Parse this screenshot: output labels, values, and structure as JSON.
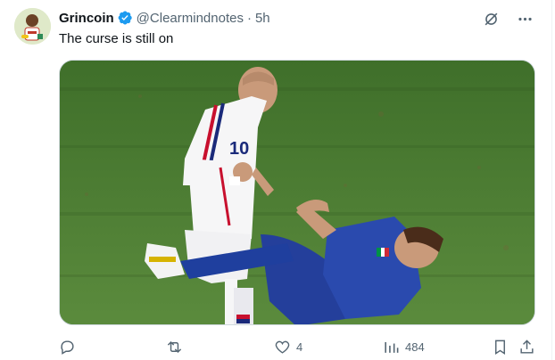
{
  "post": {
    "author_name": "Grincoin",
    "handle": "@Clearmindnotes",
    "separator": "·",
    "time": "5h",
    "text": "The curse is still on",
    "verified": true
  },
  "actions": {
    "reply_count": "",
    "repost_count": "",
    "like_count": "4",
    "views_count": "484"
  },
  "icons": {
    "header": [
      "verified-badge-icon",
      "grok-icon",
      "more-icon"
    ],
    "footer": [
      "reply-icon",
      "repost-icon",
      "like-icon",
      "views-icon",
      "bookmark-icon",
      "share-icon"
    ]
  },
  "colors": {
    "verified": "#1d9bf0",
    "secondary_text": "#536471",
    "primary_text": "#0f1419",
    "border": "#cfd9de"
  }
}
